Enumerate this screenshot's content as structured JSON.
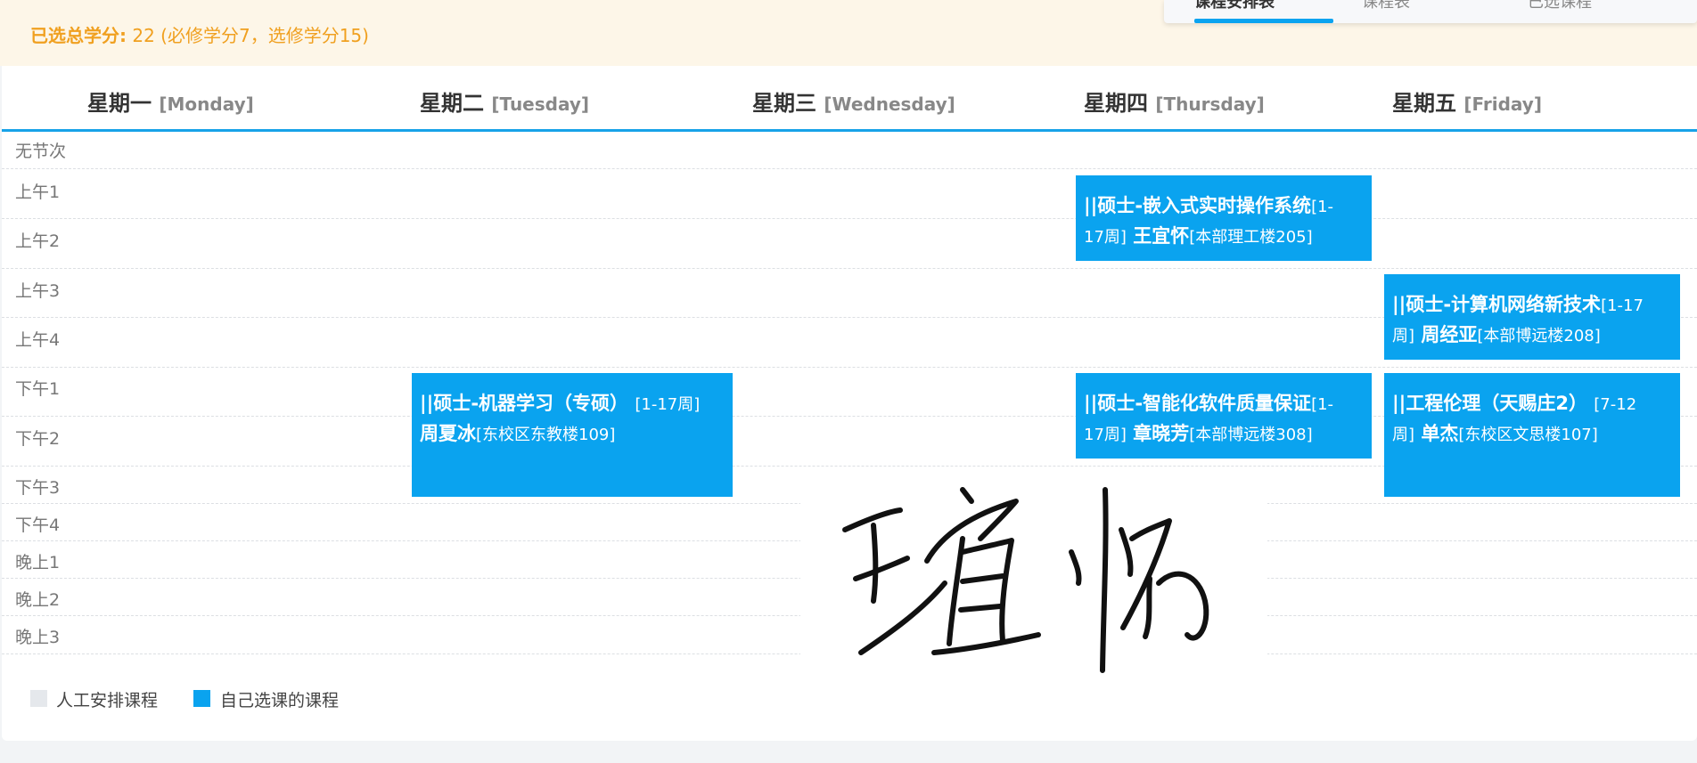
{
  "credit": {
    "label": "已选总学分:",
    "value": "22 (必修学分7，选修学分15)"
  },
  "top_tabs": [
    {
      "label": "课程安排表"
    },
    {
      "label": "课程表"
    },
    {
      "label": "已选课程"
    }
  ],
  "days": [
    {
      "cn": "星期一",
      "en": "[Monday]"
    },
    {
      "cn": "星期二",
      "en": "[Tuesday]"
    },
    {
      "cn": "星期三",
      "en": "[Wednesday]"
    },
    {
      "cn": "星期四",
      "en": "[Thursday]"
    },
    {
      "cn": "星期五",
      "en": "[Friday]"
    }
  ],
  "periods": [
    "无节次",
    "上午1",
    "上午2",
    "上午3",
    "上午4",
    "下午1",
    "下午2",
    "下午3",
    "下午4",
    "晚上1",
    "晚上2",
    "晚上3"
  ],
  "courses": [
    {
      "line1_title": "||硕士-嵌入式实时操作系统",
      "line1_meta": "[1-",
      "line2_meta": "17周]",
      "teacher": "王宜怀",
      "room": "[本部理工楼205]"
    },
    {
      "line1_title": "||硕士-计算机网络新技术",
      "line1_meta": "[1-17",
      "line2_meta": "周]",
      "teacher": "周经亚",
      "room": "[本部博远楼208]"
    },
    {
      "line1_title": "||硕士-机器学习（专硕）",
      "line1_meta": "[1-17周]",
      "line2_meta": "",
      "teacher": "周夏冰",
      "room": "[东校区东教楼109]"
    },
    {
      "line1_title": "||硕士-智能化软件质量保证",
      "line1_meta": "[1-",
      "line2_meta": "17周]",
      "teacher": "章晓芳",
      "room": "[本部博远楼308]"
    },
    {
      "line1_title": "||工程伦理（天赐庄2）",
      "line1_meta": "[7-12",
      "line2_meta": "周]",
      "teacher": "单杰",
      "room": "[东校区文思楼107]"
    }
  ],
  "legend": [
    {
      "label": "人工安排课程",
      "color": "#e5e8ec"
    },
    {
      "label": "自己选课的课程",
      "color": "#0aa3ef"
    }
  ],
  "signature": {
    "text": "王宜怀"
  },
  "colors": {
    "accent": "#0aa3ef",
    "credit_text": "#f0a020",
    "header_line": "#17a2e8"
  }
}
